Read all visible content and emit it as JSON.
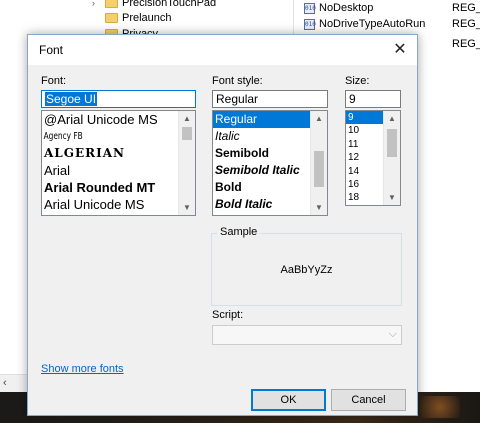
{
  "background": {
    "tree_items": [
      {
        "label": "PrecisionTouchPad",
        "has_expander": true
      },
      {
        "label": "Prelaunch",
        "has_expander": false
      },
      {
        "label": "Privacy",
        "has_expander": false
      }
    ],
    "values": [
      {
        "name": "NoDesktop",
        "type": "REG_DW"
      },
      {
        "name": "NoDriveTypeAutoRun",
        "type": "REG_DW"
      },
      {
        "name": "",
        "type": "REG_DW"
      }
    ],
    "reg_icon_text": "010"
  },
  "dialog": {
    "title": "Font",
    "font": {
      "label": "Font:",
      "value": "Segoe UI",
      "items": [
        {
          "label": "@Arial Unicode MS",
          "style": "normal"
        },
        {
          "label": "Agency FB",
          "style": "condensed"
        },
        {
          "label": "ALGERIAN",
          "style": "algerian"
        },
        {
          "label": "Arial",
          "style": "normal"
        },
        {
          "label": "Arial Rounded MT",
          "style": "bold"
        },
        {
          "label": "Arial Unicode MS",
          "style": "normal"
        }
      ]
    },
    "style": {
      "label": "Font style:",
      "value": "Regular",
      "selected_index": 0,
      "items": [
        {
          "label": "Regular",
          "style": "normal"
        },
        {
          "label": "Italic",
          "style": "italic"
        },
        {
          "label": "Semibold",
          "style": "bold"
        },
        {
          "label": "Semibold Italic",
          "style": "bold-italic"
        },
        {
          "label": "Bold",
          "style": "bold"
        },
        {
          "label": "Bold Italic",
          "style": "bold-italic"
        }
      ]
    },
    "size": {
      "label": "Size:",
      "value": "9",
      "selected_index": 0,
      "items": [
        "9",
        "10",
        "11",
        "12",
        "14",
        "16",
        "18"
      ]
    },
    "sample": {
      "label": "Sample",
      "text": "AaBbYyZz"
    },
    "script": {
      "label": "Script:",
      "value": ""
    },
    "show_more_fonts": "Show more fonts",
    "ok_label": "OK",
    "cancel_label": "Cancel"
  },
  "colors": {
    "accent": "#0078d7",
    "link": "#0066cc"
  }
}
